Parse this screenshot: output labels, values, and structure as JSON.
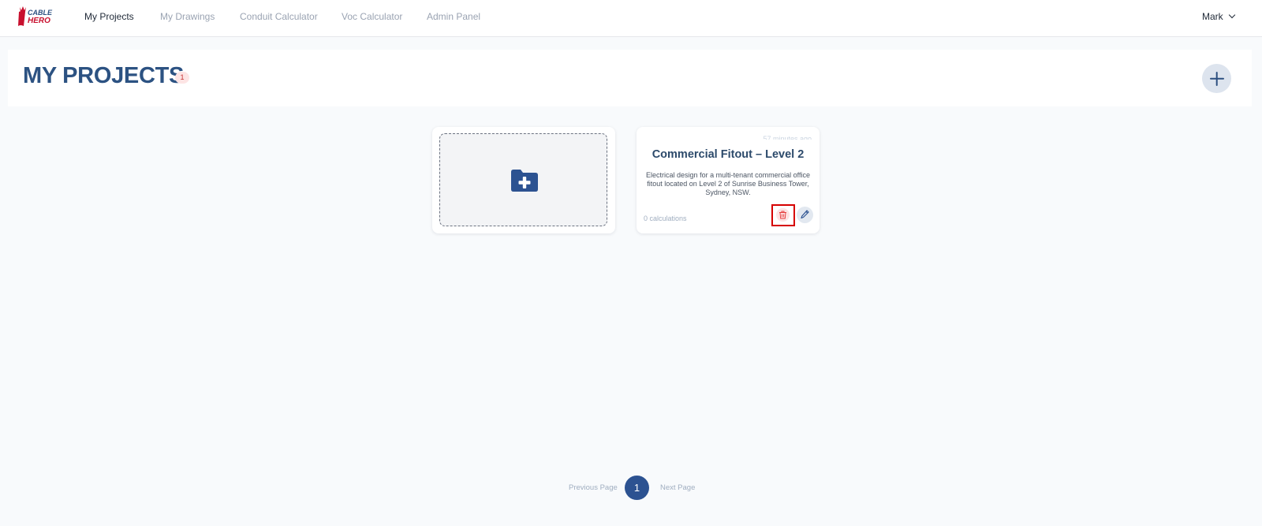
{
  "app": {
    "logo": {
      "line1": "CABLE",
      "line2": "HERO",
      "accent": "#c8102e",
      "accent_blue": "#2c5282"
    }
  },
  "nav": {
    "items": [
      {
        "label": "My Projects",
        "active": true
      },
      {
        "label": "My Drawings",
        "active": false
      },
      {
        "label": "Conduit Calculator",
        "active": false
      },
      {
        "label": "Voc Calculator",
        "active": false
      },
      {
        "label": "Admin Panel",
        "active": false
      }
    ],
    "user": {
      "name": "Mark",
      "icon": "chevron-down-icon"
    }
  },
  "header": {
    "title": "MY PROJECTS",
    "count": "1",
    "add_icon": "plus-icon"
  },
  "new_project": {
    "icon": "folder-plus-icon"
  },
  "projects": [
    {
      "timestamp": "57 minutes ago",
      "title": "Commercial Fitout – Level 2",
      "description": "Electrical design for a multi-tenant commercial office fitout located on Level 2 of Sunrise Business Tower, Sydney, NSW.",
      "calculations": "0 calculations",
      "delete_icon": "trash-icon",
      "edit_icon": "pencil-icon"
    }
  ],
  "pagination": {
    "previous_label": "Previous Page",
    "current_page": "1",
    "next_label": "Next Page"
  },
  "colors": {
    "primary": "#2c5282",
    "badge_bg": "#fde4e4",
    "badge_text": "#c53030",
    "delete_outline": "#d60000",
    "page_bg": "#f8fafc"
  }
}
